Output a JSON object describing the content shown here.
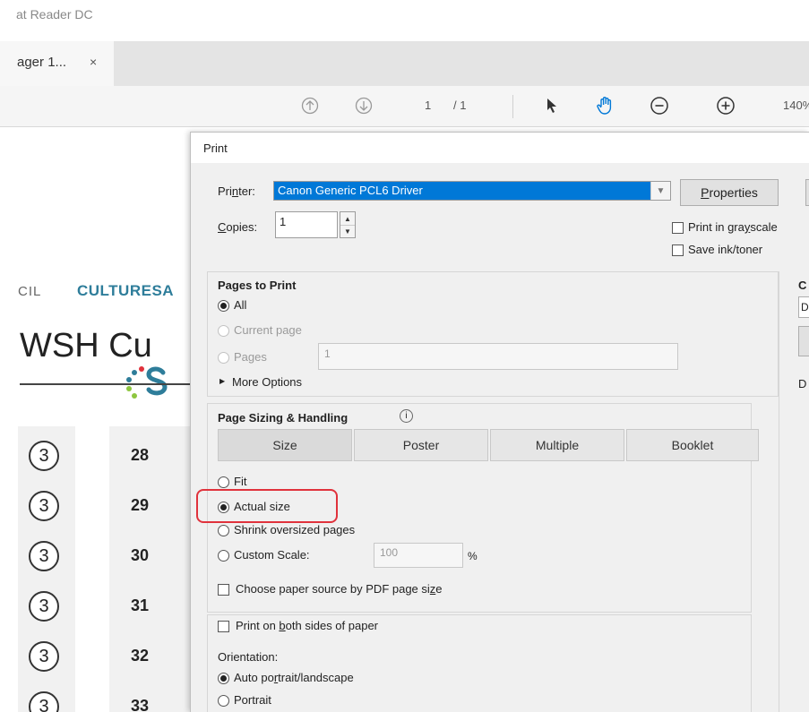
{
  "app": {
    "title": "at Reader DC"
  },
  "tab": {
    "label": "ager 1...",
    "close": "×"
  },
  "toolbar": {
    "page_current": "1",
    "page_total": "/ 1",
    "zoom": "140%"
  },
  "document": {
    "council_text": "CIL",
    "brand_text": "CULTURESA",
    "heading": "WSH Cu",
    "circle_glyph": "3",
    "rows": [
      "28",
      "29",
      "30",
      "31",
      "32",
      "33"
    ]
  },
  "dialog": {
    "title": "Print",
    "printer_label_pre": "Pri",
    "printer_label_u": "n",
    "printer_label_post": "ter:",
    "printer_value": "Canon Generic PCL6 Driver",
    "properties_pre": "",
    "properties_u": "P",
    "properties_post": "roperties",
    "copies_label_u": "C",
    "copies_label_post": "opies:",
    "copies_value": "1",
    "print_grayscale_pre": "Print in gra",
    "print_grayscale_u": "y",
    "print_grayscale_post": "scale",
    "save_ink": "Save ink/toner",
    "pages_to_print": {
      "title": "Pages to Print",
      "all": "All",
      "current_page": "Current page",
      "pages": "Pages",
      "pages_value": "1",
      "more_options": "More Options"
    },
    "right_panel_title": "C",
    "right_panel_field": "D",
    "right_panel_text": "D",
    "sizing": {
      "title": "Page Sizing & Handling",
      "info_icon_glyph": "i",
      "tabs": [
        "Size",
        "Poster",
        "Multiple",
        "Booklet"
      ],
      "fit": "Fit",
      "actual_size": "Actual size",
      "shrink": "Shrink oversized pages",
      "custom_scale": "Custom Scale:",
      "scale_value": "100",
      "scale_unit": "%",
      "paper_source_pre": "Choose paper source by PDF page si",
      "paper_source_u": "z",
      "paper_source_post": "e"
    },
    "both_sides_pre": "Print on ",
    "both_sides_u": "b",
    "both_sides_post": "oth sides of paper",
    "orientation": {
      "title": "Orientation:",
      "auto_pre": "Auto po",
      "auto_u": "r",
      "auto_post": "trait/landscape",
      "portrait": "Portrait"
    }
  },
  "colors": {
    "accent": "#0078d7",
    "highlight": "#e0323c",
    "brand": "#2e7d9a"
  }
}
